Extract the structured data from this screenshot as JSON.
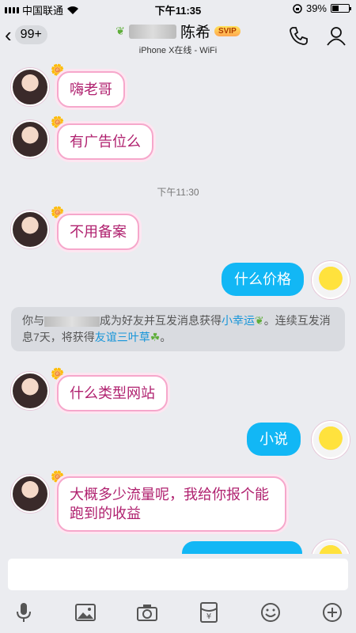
{
  "status_bar": {
    "carrier": "中国联通",
    "time": "下午11:35",
    "battery": "39%",
    "battery_level": 0.39
  },
  "nav": {
    "unread_badge": "99+",
    "contact_name": "陈希",
    "vip_badge": "SVIP",
    "subtitle": "iPhone X在线 - WiFi"
  },
  "chat": {
    "messages": [
      {
        "side": "left",
        "text": "嗨老哥"
      },
      {
        "side": "left",
        "text": "有广告位么"
      },
      {
        "side": "left",
        "text": "不用备案"
      },
      {
        "side": "right",
        "text": "什么价格"
      },
      {
        "side": "left",
        "text": "什么类型网站"
      },
      {
        "side": "right",
        "text": "小说"
      },
      {
        "side": "left",
        "text": "大概多少流量呢，我给你报个能跑到的收益"
      }
    ],
    "timestamp": "下午11:30",
    "system_message": {
      "prefix": "你与",
      "middle": "成为好友并互发消息获得",
      "highlight1": "小幸运",
      "middle2": "。连续互发消息7天，将获得",
      "highlight2": "友谊三叶草",
      "suffix": "。"
    }
  },
  "input": {
    "placeholder": ""
  },
  "toolbar": {
    "icons": [
      "microphone-icon",
      "image-icon",
      "camera-icon",
      "red-packet-icon",
      "emoji-icon",
      "plus-icon"
    ]
  },
  "colors": {
    "bubble_right": "#12b7f5",
    "bubble_left_border": "#f6a7cb",
    "bubble_left_text": "#b0216f",
    "background": "#ebecf0",
    "link": "#1695d9"
  }
}
